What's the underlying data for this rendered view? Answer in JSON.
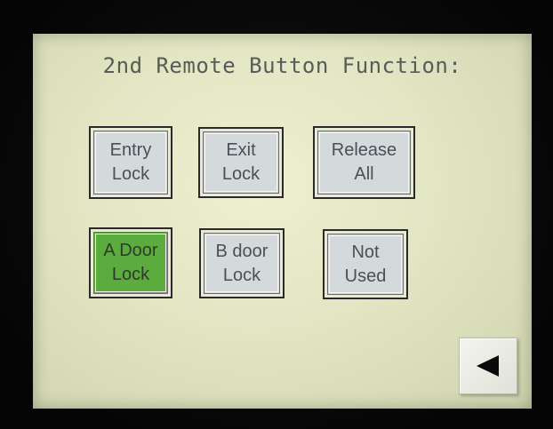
{
  "screen": {
    "title": "2nd Remote Button Function:"
  },
  "buttons": {
    "entry_lock": {
      "line1": "Entry",
      "line2": "Lock",
      "selected": false
    },
    "exit_lock": {
      "line1": "Exit",
      "line2": "Lock",
      "selected": false
    },
    "release_all": {
      "line1": "Release",
      "line2": "All",
      "selected": false
    },
    "a_door_lock": {
      "line1": "A Door",
      "line2": "Lock",
      "selected": true
    },
    "b_door_lock": {
      "line1": "B door",
      "line2": "Lock",
      "selected": false
    },
    "not_used": {
      "line1": "Not",
      "line2": "Used",
      "selected": false
    }
  },
  "navigation": {
    "back_icon": "left-triangle-icon"
  },
  "colors": {
    "screen_background": "#e2e6c3",
    "button_face": "#d4d9dc",
    "button_text": "#4c5056",
    "selected_button_face": "#5cab3e",
    "title_text": "#5a5a58",
    "bezel": "#0b0b0b"
  }
}
